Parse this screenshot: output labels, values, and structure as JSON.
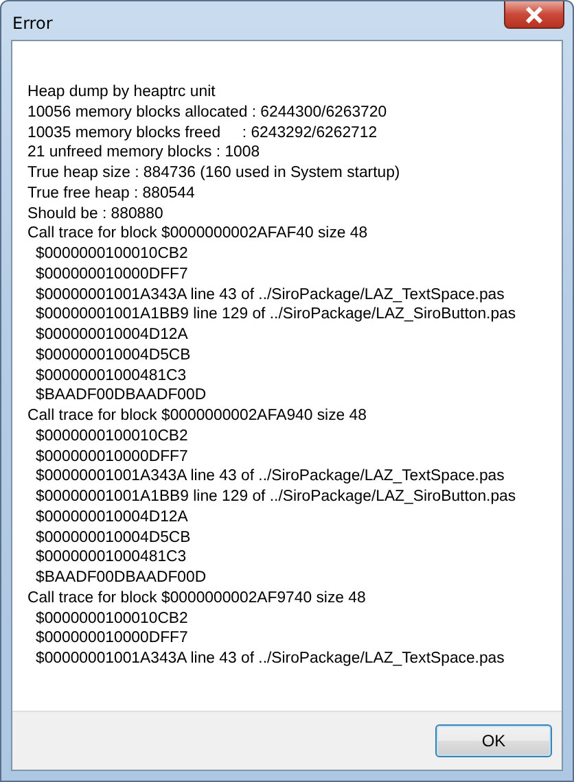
{
  "window": {
    "title": "Error"
  },
  "message": {
    "lines": [
      {
        "text": "Heap dump by heaptrc unit",
        "indent": false
      },
      {
        "text": "10056 memory blocks allocated : 6244300/6263720",
        "indent": false
      },
      {
        "text": "10035 memory blocks freed     : 6243292/6262712",
        "indent": false
      },
      {
        "text": "21 unfreed memory blocks : 1008",
        "indent": false
      },
      {
        "text": "True heap size : 884736 (160 used in System startup)",
        "indent": false
      },
      {
        "text": "True free heap : 880544",
        "indent": false
      },
      {
        "text": "Should be : 880880",
        "indent": false
      },
      {
        "text": "Call trace for block $0000000002AFAF40 size 48",
        "indent": false
      },
      {
        "text": "$0000000100010CB2",
        "indent": true
      },
      {
        "text": "$000000010000DFF7",
        "indent": true
      },
      {
        "text": "$00000001001A343A line 43 of ../SiroPackage/LAZ_TextSpace.pas",
        "indent": true
      },
      {
        "text": "$00000001001A1BB9 line 129 of ../SiroPackage/LAZ_SiroButton.pas",
        "indent": true
      },
      {
        "text": "$000000010004D12A",
        "indent": true
      },
      {
        "text": "$000000010004D5CB",
        "indent": true
      },
      {
        "text": "$00000001000481C3",
        "indent": true
      },
      {
        "text": "$BAADF00DBAADF00D",
        "indent": true
      },
      {
        "text": "Call trace for block $0000000002AFA940 size 48",
        "indent": false
      },
      {
        "text": "$0000000100010CB2",
        "indent": true
      },
      {
        "text": "$000000010000DFF7",
        "indent": true
      },
      {
        "text": "$00000001001A343A line 43 of ../SiroPackage/LAZ_TextSpace.pas",
        "indent": true
      },
      {
        "text": "$00000001001A1BB9 line 129 of ../SiroPackage/LAZ_SiroButton.pas",
        "indent": true
      },
      {
        "text": "$000000010004D12A",
        "indent": true
      },
      {
        "text": "$000000010004D5CB",
        "indent": true
      },
      {
        "text": "$00000001000481C3",
        "indent": true
      },
      {
        "text": "$BAADF00DBAADF00D",
        "indent": true
      },
      {
        "text": "Call trace for block $0000000002AF9740 size 48",
        "indent": false
      },
      {
        "text": "$0000000100010CB2",
        "indent": true
      },
      {
        "text": "$000000010000DFF7",
        "indent": true
      },
      {
        "text": "$00000001001A343A line 43 of ../SiroPackage/LAZ_TextSpace.pas",
        "indent": true
      }
    ]
  },
  "buttons": [
    {
      "label": "OK"
    }
  ]
}
